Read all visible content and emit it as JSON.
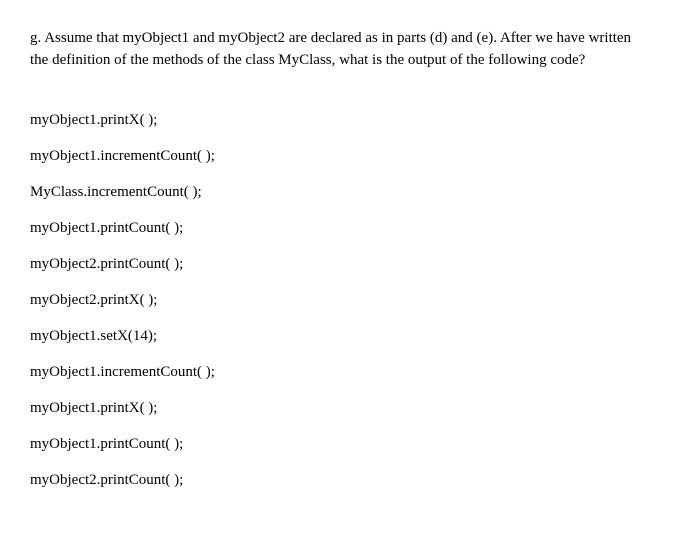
{
  "question": {
    "label": "g.",
    "text": "Assume that myObject1 and myObject2 are declared as in parts (d) and (e). After we have written the definition of the methods of the class MyClass, what is the output of the following code?"
  },
  "code": {
    "lines": [
      "myObject1.printX( );",
      "myObject1.incrementCount( );",
      "MyClass.incrementCount( );",
      "myObject1.printCount( );",
      "myObject2.printCount( );",
      "myObject2.printX( );",
      "myObject1.setX(14);",
      "myObject1.incrementCount( );",
      "myObject1.printX( );",
      "myObject1.printCount( );",
      "myObject2.printCount( );"
    ]
  }
}
